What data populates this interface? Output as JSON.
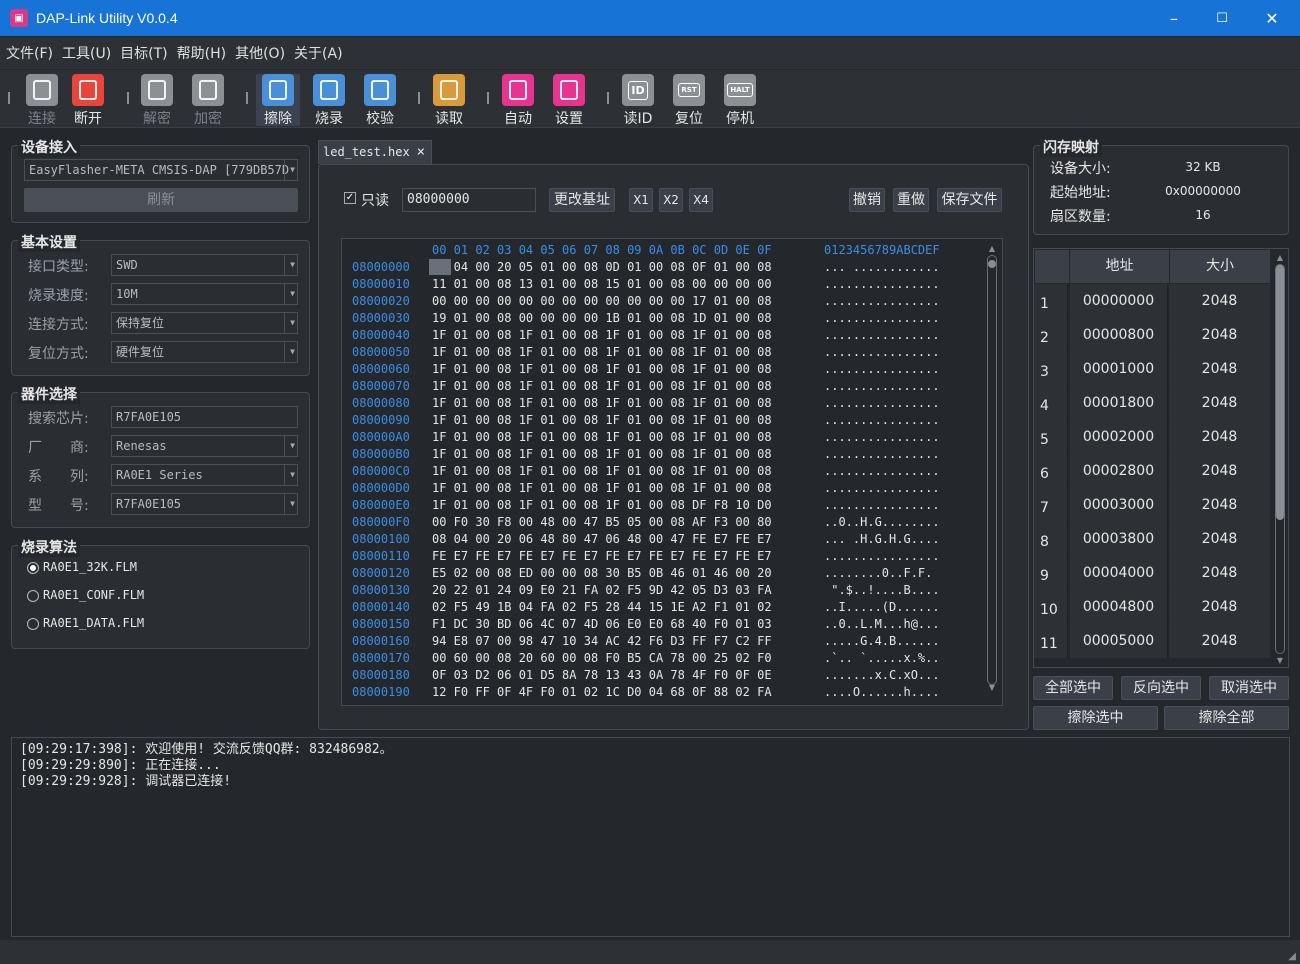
{
  "window": {
    "title": "DAP-Link Utility V0.0.4",
    "app_icon": "chip-icon",
    "controls": [
      "–",
      "☐",
      "✕"
    ]
  },
  "menu": [
    "文件(F)",
    "工具(U)",
    "目标(T)",
    "帮助(H)",
    "其他(O)",
    "关于(A)"
  ],
  "toolbar": [
    {
      "label": "连接",
      "icon": "connect-icon",
      "color": "#8c8f94",
      "disabled": true
    },
    {
      "label": "断开",
      "icon": "disconnect-icon",
      "color": "#e8453c",
      "disabled": false
    },
    {
      "label": "解密",
      "icon": "unlock-icon",
      "color": "#8c8f94",
      "disabled": true
    },
    {
      "label": "加密",
      "icon": "lock-icon",
      "color": "#8c8f94",
      "disabled": true
    },
    {
      "label": "擦除",
      "icon": "erase-icon",
      "color": "#4a90d9",
      "disabled": false,
      "selected": true
    },
    {
      "label": "烧录",
      "icon": "program-icon",
      "color": "#4a90d9",
      "disabled": false
    },
    {
      "label": "校验",
      "icon": "verify-icon",
      "color": "#4a90d9",
      "disabled": false
    },
    {
      "label": "读取",
      "icon": "read-icon",
      "color": "#d99a3a",
      "disabled": false
    },
    {
      "label": "自动",
      "icon": "robot-icon",
      "color": "#e6348f",
      "disabled": false
    },
    {
      "label": "设置",
      "icon": "gear-icon",
      "color": "#e6348f",
      "disabled": false
    },
    {
      "label": "读ID",
      "icon": "id-icon",
      "color": "#8c8f94",
      "disabled": false,
      "glyph": "ID"
    },
    {
      "label": "复位",
      "icon": "reset-icon",
      "color": "#8c8f94",
      "disabled": false,
      "glyph": "RST"
    },
    {
      "label": "停机",
      "icon": "halt-icon",
      "color": "#8c8f94",
      "disabled": false,
      "glyph": "HALT"
    }
  ],
  "device": {
    "title": "设备接入",
    "probe": "EasyFlasher-META CMSIS-DAP [779DB57D",
    "refresh": "刷新"
  },
  "basic": {
    "title": "基本设置",
    "rows": [
      {
        "label": "接口类型:",
        "value": "SWD"
      },
      {
        "label": "烧录速度:",
        "value": "10M"
      },
      {
        "label": "连接方式:",
        "value": "保持复位"
      },
      {
        "label": "复位方式:",
        "value": "硬件复位"
      }
    ]
  },
  "chip": {
    "title": "器件选择",
    "rows": [
      {
        "label": "搜索芯片:",
        "value": "R7FA0E105",
        "dropdown": false
      },
      {
        "label": "厂　　商:",
        "value": "Renesas",
        "dropdown": true
      },
      {
        "label": "系　　列:",
        "value": "RA0E1 Series",
        "dropdown": true
      },
      {
        "label": "型　　号:",
        "value": "R7FA0E105",
        "dropdown": true
      }
    ]
  },
  "algo": {
    "title": "烧录算法",
    "items": [
      {
        "label": "RA0E1_32K.FLM",
        "checked": true
      },
      {
        "label": "RA0E1_CONF.FLM",
        "checked": false
      },
      {
        "label": "RA0E1_DATA.FLM",
        "checked": false
      }
    ]
  },
  "tab": {
    "label": "led_test.hex",
    "close": "×"
  },
  "editor": {
    "readonly_label": "只读",
    "readonly": true,
    "base_addr": "08000000",
    "change_base": "更改基址",
    "x1": "X1",
    "x2": "X2",
    "x4": "X4",
    "undo": "撤销",
    "redo": "重做",
    "save": "保存文件"
  },
  "hex_header": "00 01 02 03 04 05 06 07 08 09 0A 0B 0C 0D 0E 0F",
  "ascii_header": "0123456789ABCDEF",
  "hex_rows": [
    {
      "addr": "08000000",
      "bytes": "08 04 00 20 05 01 00 08 0D 01 00 08 0F 01 00 08",
      "ascii": "... ............"
    },
    {
      "addr": "08000010",
      "bytes": "11 01 00 08 13 01 00 08 15 01 00 08 00 00 00 00",
      "ascii": "................"
    },
    {
      "addr": "08000020",
      "bytes": "00 00 00 00 00 00 00 00 00 00 00 00 17 01 00 08",
      "ascii": "................"
    },
    {
      "addr": "08000030",
      "bytes": "19 01 00 08 00 00 00 00 1B 01 00 08 1D 01 00 08",
      "ascii": "................"
    },
    {
      "addr": "08000040",
      "bytes": "1F 01 00 08 1F 01 00 08 1F 01 00 08 1F 01 00 08",
      "ascii": "................"
    },
    {
      "addr": "08000050",
      "bytes": "1F 01 00 08 1F 01 00 08 1F 01 00 08 1F 01 00 08",
      "ascii": "................"
    },
    {
      "addr": "08000060",
      "bytes": "1F 01 00 08 1F 01 00 08 1F 01 00 08 1F 01 00 08",
      "ascii": "................"
    },
    {
      "addr": "08000070",
      "bytes": "1F 01 00 08 1F 01 00 08 1F 01 00 08 1F 01 00 08",
      "ascii": "................"
    },
    {
      "addr": "08000080",
      "bytes": "1F 01 00 08 1F 01 00 08 1F 01 00 08 1F 01 00 08",
      "ascii": "................"
    },
    {
      "addr": "08000090",
      "bytes": "1F 01 00 08 1F 01 00 08 1F 01 00 08 1F 01 00 08",
      "ascii": "................"
    },
    {
      "addr": "080000A0",
      "bytes": "1F 01 00 08 1F 01 00 08 1F 01 00 08 1F 01 00 08",
      "ascii": "................"
    },
    {
      "addr": "080000B0",
      "bytes": "1F 01 00 08 1F 01 00 08 1F 01 00 08 1F 01 00 08",
      "ascii": "................"
    },
    {
      "addr": "080000C0",
      "bytes": "1F 01 00 08 1F 01 00 08 1F 01 00 08 1F 01 00 08",
      "ascii": "................"
    },
    {
      "addr": "080000D0",
      "bytes": "1F 01 00 08 1F 01 00 08 1F 01 00 08 1F 01 00 08",
      "ascii": "................"
    },
    {
      "addr": "080000E0",
      "bytes": "1F 01 00 08 1F 01 00 08 1F 01 00 08 DF F8 10 D0",
      "ascii": "................"
    },
    {
      "addr": "080000F0",
      "bytes": "00 F0 30 F8 00 48 00 47 B5 05 00 08 AF F3 00 80",
      "ascii": "..0..H.G........"
    },
    {
      "addr": "08000100",
      "bytes": "08 04 00 20 06 48 80 47 06 48 00 47 FE E7 FE E7",
      "ascii": "... .H.G.H.G...."
    },
    {
      "addr": "08000110",
      "bytes": "FE E7 FE E7 FE E7 FE E7 FE E7 FE E7 FE E7 FE E7",
      "ascii": "................"
    },
    {
      "addr": "08000120",
      "bytes": "E5 02 00 08 ED 00 00 08 30 B5 0B 46 01 46 00 20",
      "ascii": "........0..F.F. "
    },
    {
      "addr": "08000130",
      "bytes": "20 22 01 24 09 E0 21 FA 02 F5 9D 42 05 D3 03 FA",
      "ascii": " \".$..!....B...."
    },
    {
      "addr": "08000140",
      "bytes": "02 F5 49 1B 04 FA 02 F5 28 44 15 1E A2 F1 01 02",
      "ascii": "..I.....(D......"
    },
    {
      "addr": "08000150",
      "bytes": "F1 DC 30 BD 06 4C 07 4D 06 E0 E0 68 40 F0 01 03",
      "ascii": "..0..L.M...h@..."
    },
    {
      "addr": "08000160",
      "bytes": "94 E8 07 00 98 47 10 34 AC 42 F6 D3 FF F7 C2 FF",
      "ascii": ".....G.4.B......"
    },
    {
      "addr": "08000170",
      "bytes": "00 60 00 08 20 60 00 08 F0 B5 CA 78 00 25 02 F0",
      "ascii": ".`.. `.....x.%.."
    },
    {
      "addr": "08000180",
      "bytes": "0F 03 D2 06 01 D5 8A 78 13 43 0A 78 4F F0 0F 0E",
      "ascii": ".......x.C.xO..."
    },
    {
      "addr": "08000190",
      "bytes": "12 F0 FF 0F 4F F0 01 02 1C D0 04 68 0F 88 02 FA",
      "ascii": "....O......h...."
    }
  ],
  "flash": {
    "title": "闪存映射",
    "size_label": "设备大小:",
    "size": "32 KB",
    "start_label": "起始地址:",
    "start": "0x00000000",
    "sectors_label": "扇区数量:",
    "sectors": "16"
  },
  "flash_table": {
    "headers": [
      "地址",
      "大小"
    ],
    "rows": [
      [
        "1",
        "00000000",
        "2048"
      ],
      [
        "2",
        "00000800",
        "2048"
      ],
      [
        "3",
        "00001000",
        "2048"
      ],
      [
        "4",
        "00001800",
        "2048"
      ],
      [
        "5",
        "00002000",
        "2048"
      ],
      [
        "6",
        "00002800",
        "2048"
      ],
      [
        "7",
        "00003000",
        "2048"
      ],
      [
        "8",
        "00003800",
        "2048"
      ],
      [
        "9",
        "00004000",
        "2048"
      ],
      [
        "10",
        "00004800",
        "2048"
      ],
      [
        "11",
        "00005000",
        "2048"
      ]
    ]
  },
  "flash_buttons": {
    "select_all": "全部选中",
    "invert": "反向选中",
    "deselect": "取消选中",
    "erase_sel": "擦除选中",
    "erase_all": "擦除全部"
  },
  "log": [
    "[09:29:17:398]: 欢迎使用! 交流反馈QQ群: 832486982。",
    "[09:29:29:890]: 正在连接...",
    "[09:29:29:928]: 调试器已连接!"
  ]
}
